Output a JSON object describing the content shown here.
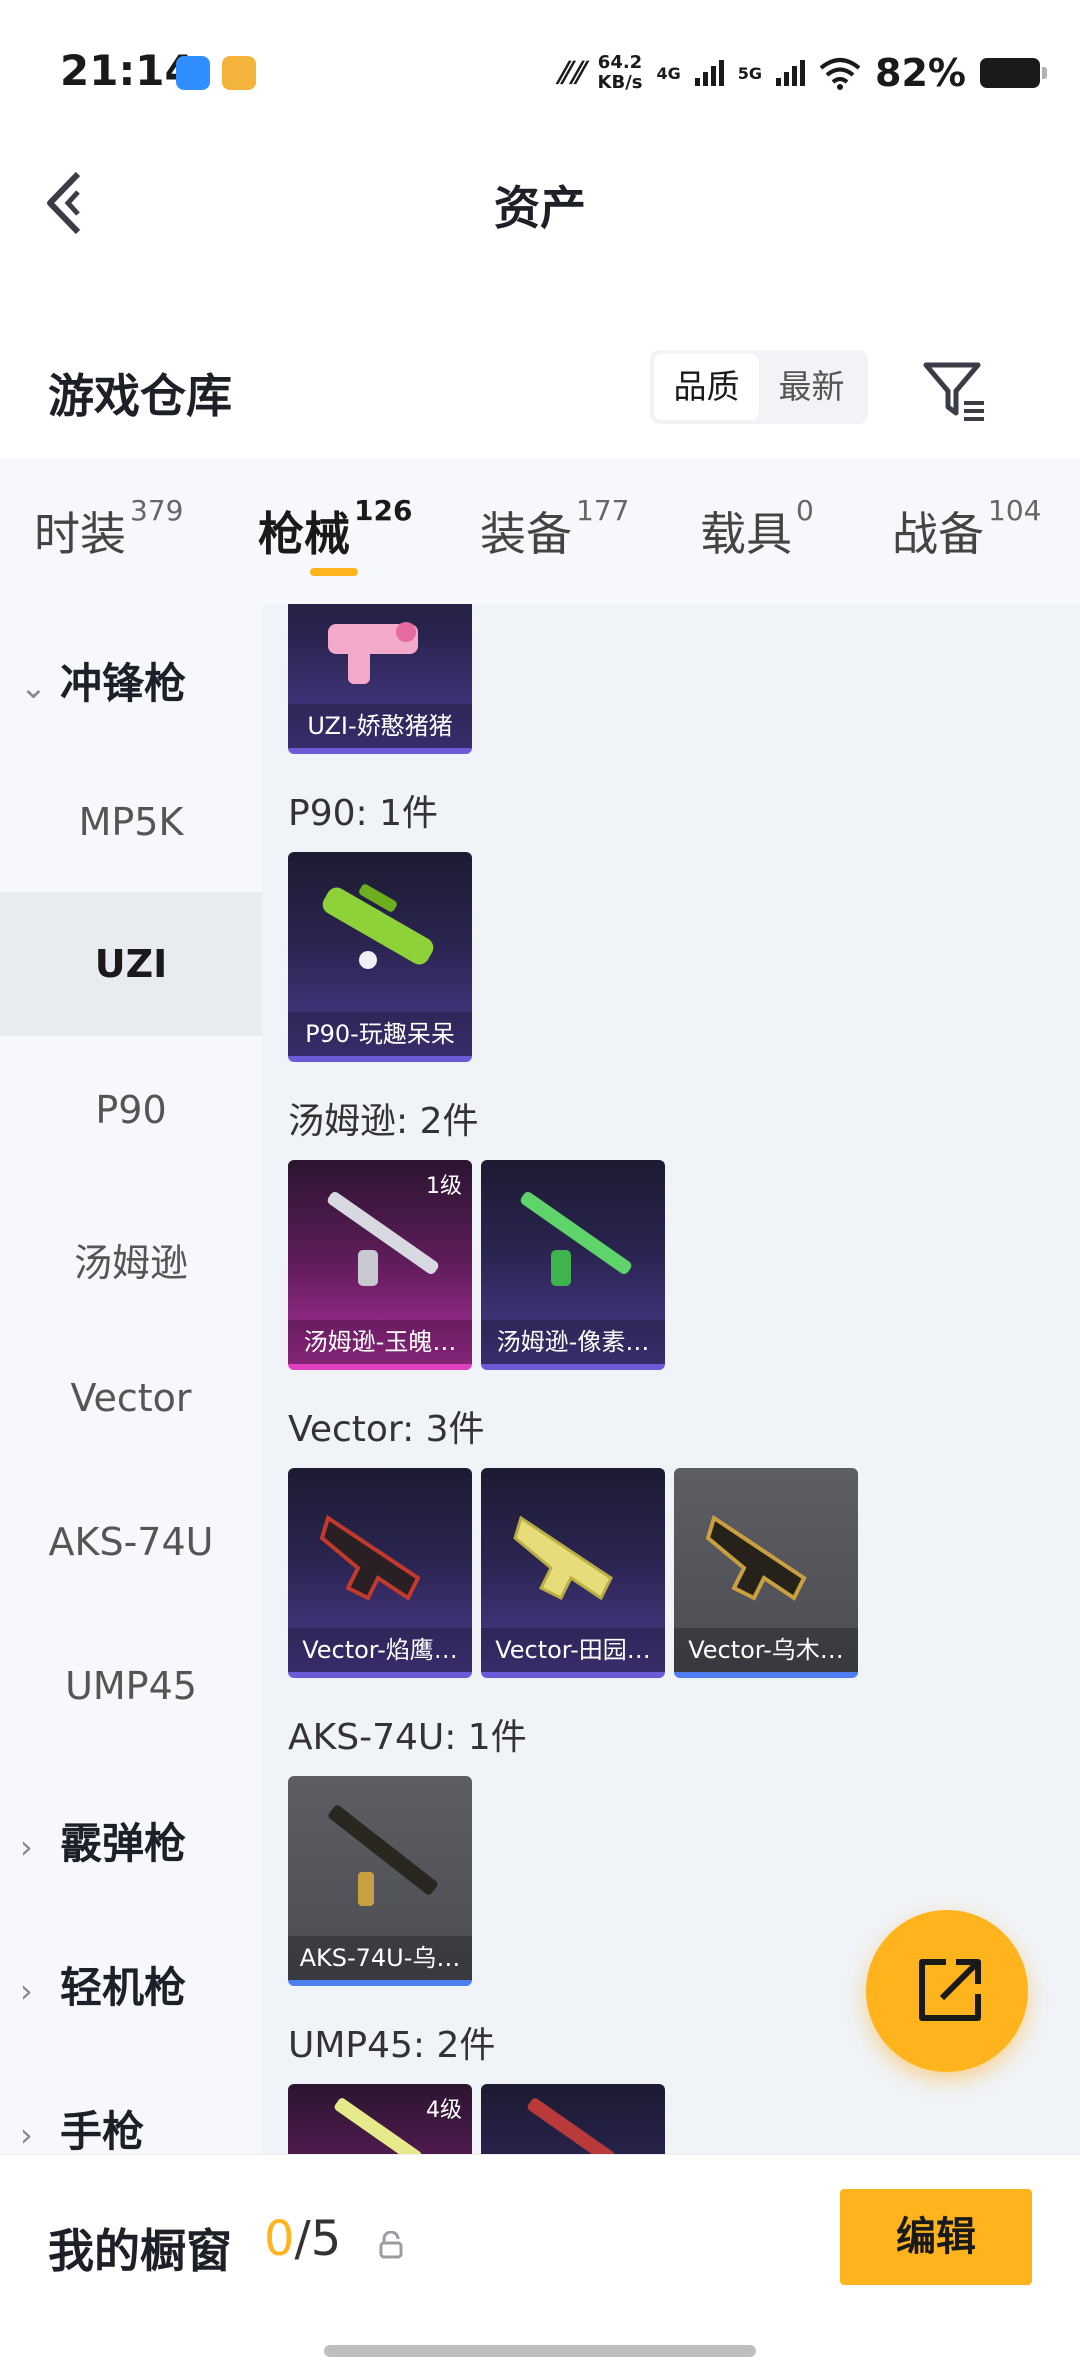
{
  "status_bar": {
    "time": "21:14",
    "speed_value": "64.2",
    "speed_unit": "KB/s",
    "net1": "4G",
    "net2": "5G",
    "battery": "82%"
  },
  "header": {
    "title": "资产"
  },
  "warehouse": {
    "title": "游戏仓库",
    "sort_options": [
      "品质",
      "最新"
    ],
    "sort_selected": "品质"
  },
  "tabs": [
    {
      "label": "时装",
      "count": "379"
    },
    {
      "label": "枪械",
      "count": "126",
      "active": true
    },
    {
      "label": "装备",
      "count": "177"
    },
    {
      "label": "载具",
      "count": "0"
    },
    {
      "label": "战备",
      "count": "104"
    }
  ],
  "sidebar": {
    "categories": [
      "冲锋枪",
      "霰弹枪",
      "轻机枪",
      "手枪"
    ],
    "subitems": [
      "MP5K",
      "UZI",
      "P90",
      "汤姆逊",
      "Vector",
      "AKS-74U",
      "UMP45"
    ],
    "selected": "UZI"
  },
  "groups": [
    {
      "label": "",
      "items": [
        {
          "name": "UZI-娇憨猪猪",
          "rarity": "purple",
          "level": ""
        }
      ]
    },
    {
      "label": "P90: 1件",
      "items": [
        {
          "name": "P90-玩趣呆呆",
          "rarity": "purple",
          "level": ""
        }
      ]
    },
    {
      "label": "汤姆逊: 2件",
      "items": [
        {
          "name": "汤姆逊-玉魄…",
          "rarity": "pink",
          "level": "1级"
        },
        {
          "name": "汤姆逊-像素…",
          "rarity": "purple",
          "level": ""
        }
      ]
    },
    {
      "label": "Vector: 3件",
      "items": [
        {
          "name": "Vector-焰鹰…",
          "rarity": "purple",
          "level": ""
        },
        {
          "name": "Vector-田园…",
          "rarity": "purple",
          "level": ""
        },
        {
          "name": "Vector-乌木…",
          "rarity": "gray",
          "level": ""
        }
      ]
    },
    {
      "label": "AKS-74U: 1件",
      "items": [
        {
          "name": "AKS-74U-乌…",
          "rarity": "gray",
          "level": ""
        }
      ]
    },
    {
      "label": "UMP45: 2件",
      "items": [
        {
          "name": "",
          "rarity": "pink",
          "level": "4级"
        },
        {
          "name": "",
          "rarity": "purple",
          "level": ""
        }
      ]
    }
  ],
  "showcase": {
    "title": "我的橱窗",
    "current": "0",
    "separator": "/",
    "max": "5",
    "edit_label": "编辑"
  },
  "colors": {
    "accent": "#ffb41e",
    "purple": "#6b5bd6",
    "pink": "#e040c0",
    "gray": "#4e7ff0"
  },
  "icons": {
    "back": "chevron-left-icon",
    "filter": "filter-icon",
    "share": "share-out-icon",
    "lock": "lock-icon"
  }
}
